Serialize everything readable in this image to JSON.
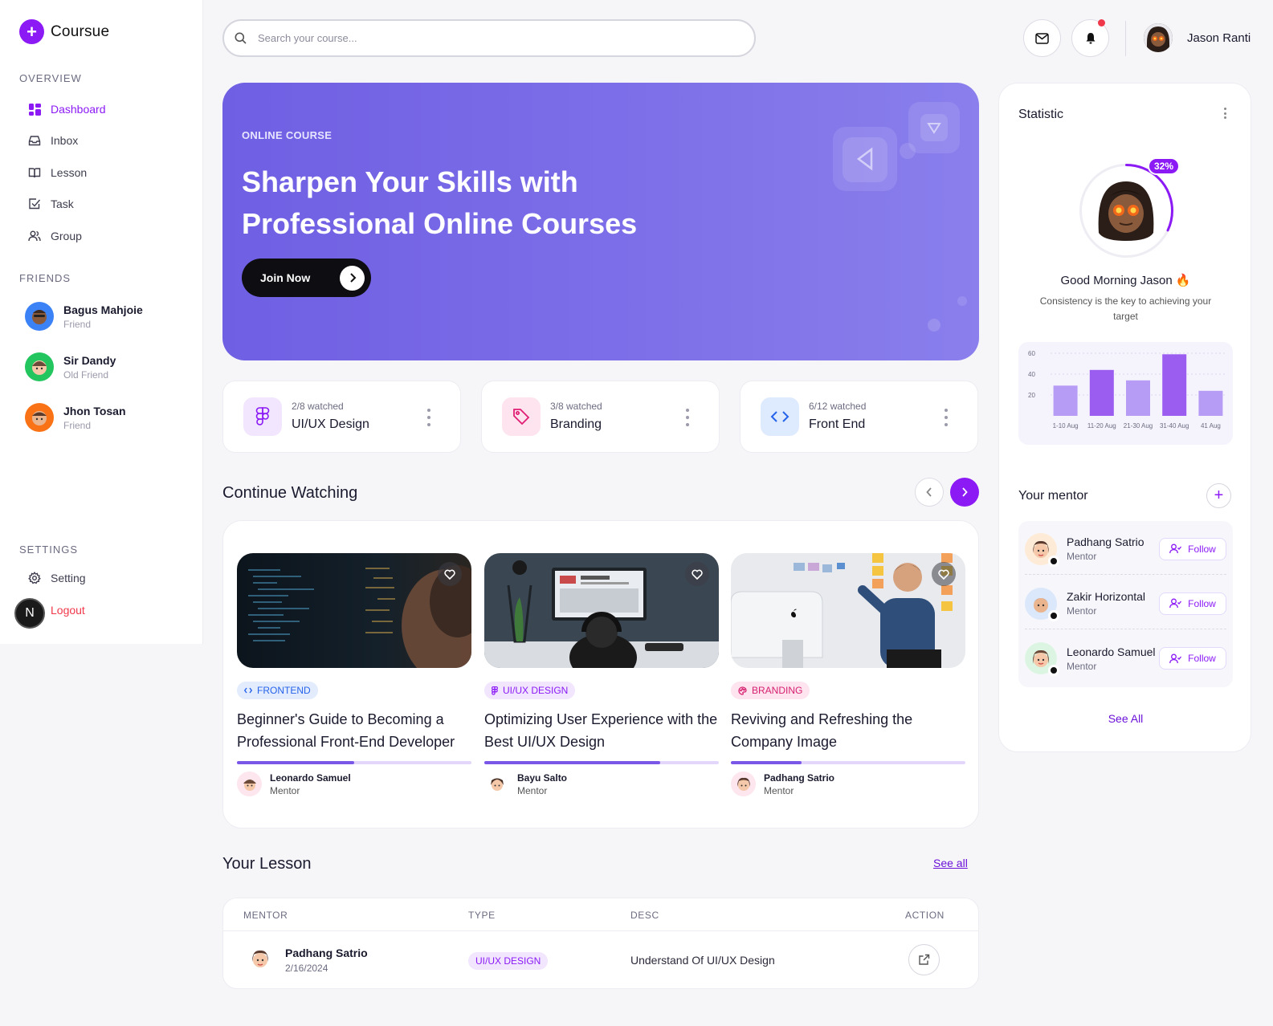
{
  "app": {
    "name": "Coursue"
  },
  "sidebar": {
    "overview_title": "OVERVIEW",
    "nav": [
      {
        "label": "Dashboard",
        "icon": "dashboard-icon"
      },
      {
        "label": "Inbox",
        "icon": "inbox-icon"
      },
      {
        "label": "Lesson",
        "icon": "book-icon"
      },
      {
        "label": "Task",
        "icon": "task-icon"
      },
      {
        "label": "Group",
        "icon": "group-icon"
      }
    ],
    "friends_title": "FRIENDS",
    "friends": [
      {
        "name": "Bagus Mahjoie",
        "relation": "Friend",
        "color": "#3b82f6"
      },
      {
        "name": "Sir Dandy",
        "relation": "Old Friend",
        "color": "#22c55e"
      },
      {
        "name": "Jhon Tosan",
        "relation": "Friend",
        "color": "#f97316"
      }
    ],
    "settings_title": "SETTINGS",
    "setting_label": "Setting",
    "logout_label": "Logout",
    "floating_badge": "N"
  },
  "header": {
    "search_placeholder": "Search your course...",
    "user_name": "Jason Ranti"
  },
  "hero": {
    "tag": "ONLINE COURSE",
    "title": "Sharpen Your Skills with Professional Online Courses",
    "button": "Join Now"
  },
  "courses": [
    {
      "progress": "2/8 watched",
      "title": "UI/UX Design",
      "icon": "figma-icon",
      "color": "#8b1af5"
    },
    {
      "progress": "3/8 watched",
      "title": "Branding",
      "icon": "tag-icon",
      "color": "#e11d74"
    },
    {
      "progress": "6/12 watched",
      "title": "Front End",
      "icon": "code-icon",
      "color": "#2563eb"
    }
  ],
  "continue": {
    "title": "Continue Watching",
    "cards": [
      {
        "tag": "FRONTEND",
        "title": "Beginner's Guide to Becoming a Professional Front-End Developer",
        "mentor": "Leonardo Samuel",
        "role": "Mentor",
        "progress": 0.5
      },
      {
        "tag": "UI/UX DESIGN",
        "title": "Optimizing User Experience with the Best UI/UX Design",
        "mentor": "Bayu Salto",
        "role": "Mentor",
        "progress": 0.75
      },
      {
        "tag": "BRANDING",
        "title": "Reviving and Refreshing the Company Image",
        "mentor": "Padhang Satrio",
        "role": "Mentor",
        "progress": 0.3
      }
    ]
  },
  "lesson": {
    "title": "Your Lesson",
    "see_all": "See all",
    "columns": [
      "MENTOR",
      "TYPE",
      "DESC",
      "ACTION"
    ],
    "rows": [
      {
        "mentor": "Padhang Satrio",
        "date": "2/16/2024",
        "type": "UI/UX DESIGN",
        "desc": "Understand Of UI/UX Design"
      }
    ]
  },
  "stats": {
    "title": "Statistic",
    "percent": "32%",
    "percent_value": 0.32,
    "greeting": "Good Morning Jason",
    "greeting_emoji": "🔥",
    "motto": "Consistency is the key to achieving your target"
  },
  "chart_data": {
    "type": "bar",
    "categories": [
      "1-10 Aug",
      "11-20 Aug",
      "21-30 Aug",
      "31-40 Aug",
      "41 Aug"
    ],
    "values": [
      29,
      44,
      34,
      59,
      24
    ],
    "yticks": [
      20,
      40,
      60
    ],
    "ylim": [
      0,
      60
    ],
    "grid": true,
    "colors": [
      "#b79cf5",
      "#9b5cf0",
      "#b79cf5",
      "#9b5cf0",
      "#b79cf5"
    ]
  },
  "mentors": {
    "title": "Your mentor",
    "list": [
      {
        "name": "Padhang Satrio",
        "role": "Mentor",
        "follow": "Follow",
        "bg": "#fdebd7"
      },
      {
        "name": "Zakir Horizontal",
        "role": "Mentor",
        "follow": "Follow",
        "bg": "#dbe7fb"
      },
      {
        "name": "Leonardo Samuel",
        "role": "Mentor",
        "follow": "Follow",
        "bg": "#dcf5e3"
      }
    ],
    "see_all": "See All"
  },
  "colors": {
    "accent": "#8b1af5",
    "danger": "#f0384b"
  }
}
